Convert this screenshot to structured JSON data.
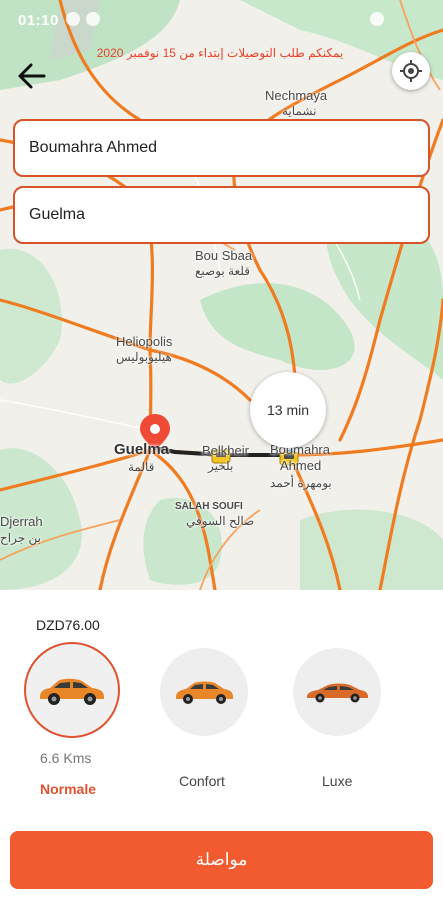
{
  "status_bar": {
    "time": "01:10"
  },
  "notice": "يمكنكم طلب التوصيلات إبتداء من 15 نوفمبر 2020",
  "route": {
    "from": "Boumahra Ahmed",
    "to": "Guelma",
    "eta": "13 min"
  },
  "map_labels": {
    "nechmaya": "Nechmaya",
    "nechmaya_ar": "نشماية",
    "bou_sbaa": "Bou Sbaa",
    "bou_sbaa_ar": "قلعة بوصبع",
    "heliopolis": "Heliopolis",
    "heliopolis_ar": "هيليوبوليس",
    "guelma": "Guelma",
    "guelma_ar": "قالمة",
    "belkheir": "Belkheir",
    "belkheir_ar": "بلخير",
    "boumahra": "Boumahra",
    "ahmed": "Ahmed",
    "boumahra_ar": "بومهرة أحمد",
    "salah_soufi": "SALAH SOUFI",
    "salah_soufi_ar": "صالح السوفي",
    "djerrah": "Djerrah",
    "djerrah_ar": "بن جراح"
  },
  "price": "DZD76.00",
  "distance": "6.6 Kms",
  "car_options": [
    {
      "label": "Normale",
      "selected": true,
      "color": "#e8862a"
    },
    {
      "label": "Confort",
      "selected": false,
      "color": "#e8862a"
    },
    {
      "label": "Luxe",
      "selected": false,
      "color": "#d86a2a"
    }
  ],
  "cta_label": "مواصلة",
  "colors": {
    "accent": "#f25a2f",
    "border": "#d65428",
    "road": "#f07c22",
    "route": "#222222"
  }
}
